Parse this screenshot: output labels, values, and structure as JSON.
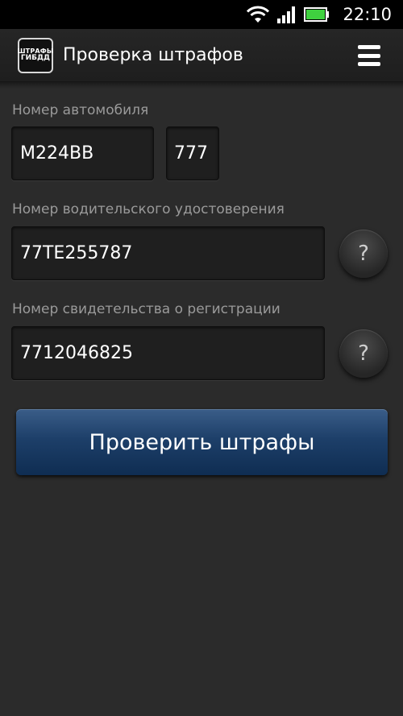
{
  "status_bar": {
    "time": "22:10",
    "icons": [
      "wifi-icon",
      "signal-icon",
      "battery-icon"
    ]
  },
  "app_bar": {
    "logo_line1": "ШТРАФЫ",
    "logo_line2": "ГИБДД",
    "title": "Проверка штрафов",
    "menu_icon": "menu-icon"
  },
  "form": {
    "car_number_label": "Номер автомобиля",
    "car_number_value": "М224ВВ",
    "car_region_value": "777",
    "license_label": "Номер водительского удостоверения",
    "license_value": "77ТЕ255787",
    "registration_label": "Номер свидетельства о регистрации",
    "registration_value": "7712046825",
    "help_label": "?",
    "submit_label": "Проверить штрафы"
  },
  "colors": {
    "background": "#2b2b2b",
    "button_blue": "#1d3f69",
    "battery_green": "#3fd13f"
  }
}
